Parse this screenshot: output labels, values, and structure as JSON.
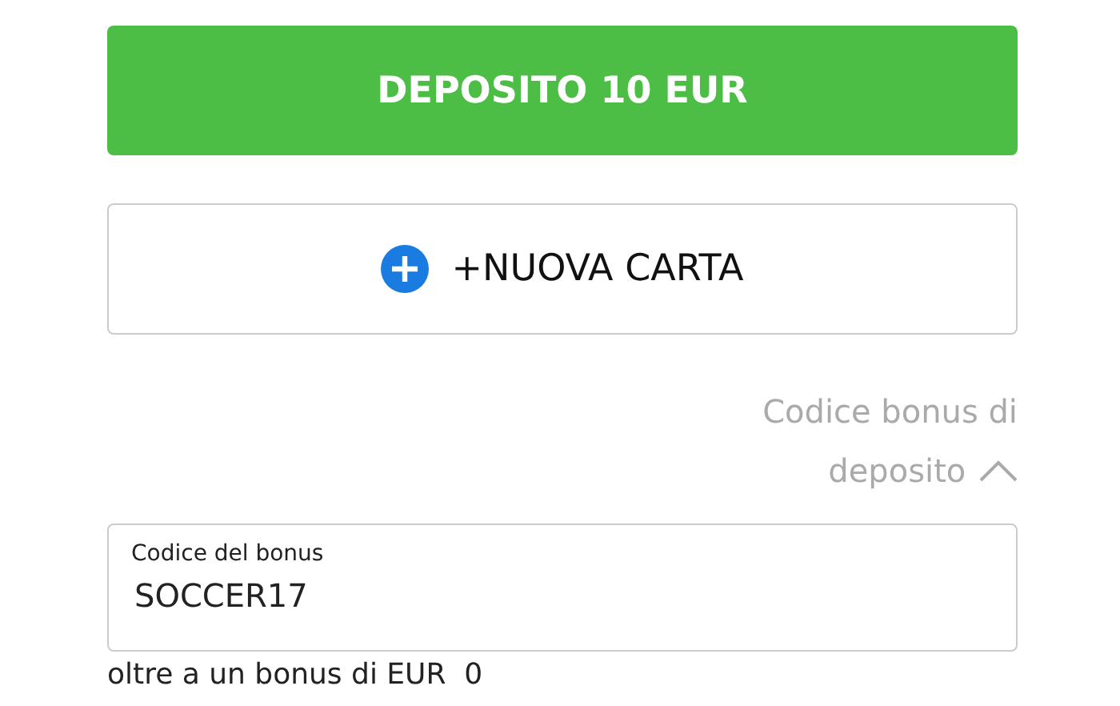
{
  "deposit_button": {
    "label": "DEPOSITO 10 EUR"
  },
  "new_card_button": {
    "label": "+NUOVA CARTA"
  },
  "bonus_toggle": {
    "label": "Codice bonus di deposito",
    "expanded": true
  },
  "bonus_field": {
    "label": "Codice del bonus",
    "value": "SOCCER17"
  },
  "bonus_note": "oltre a un bonus di EUR  0"
}
